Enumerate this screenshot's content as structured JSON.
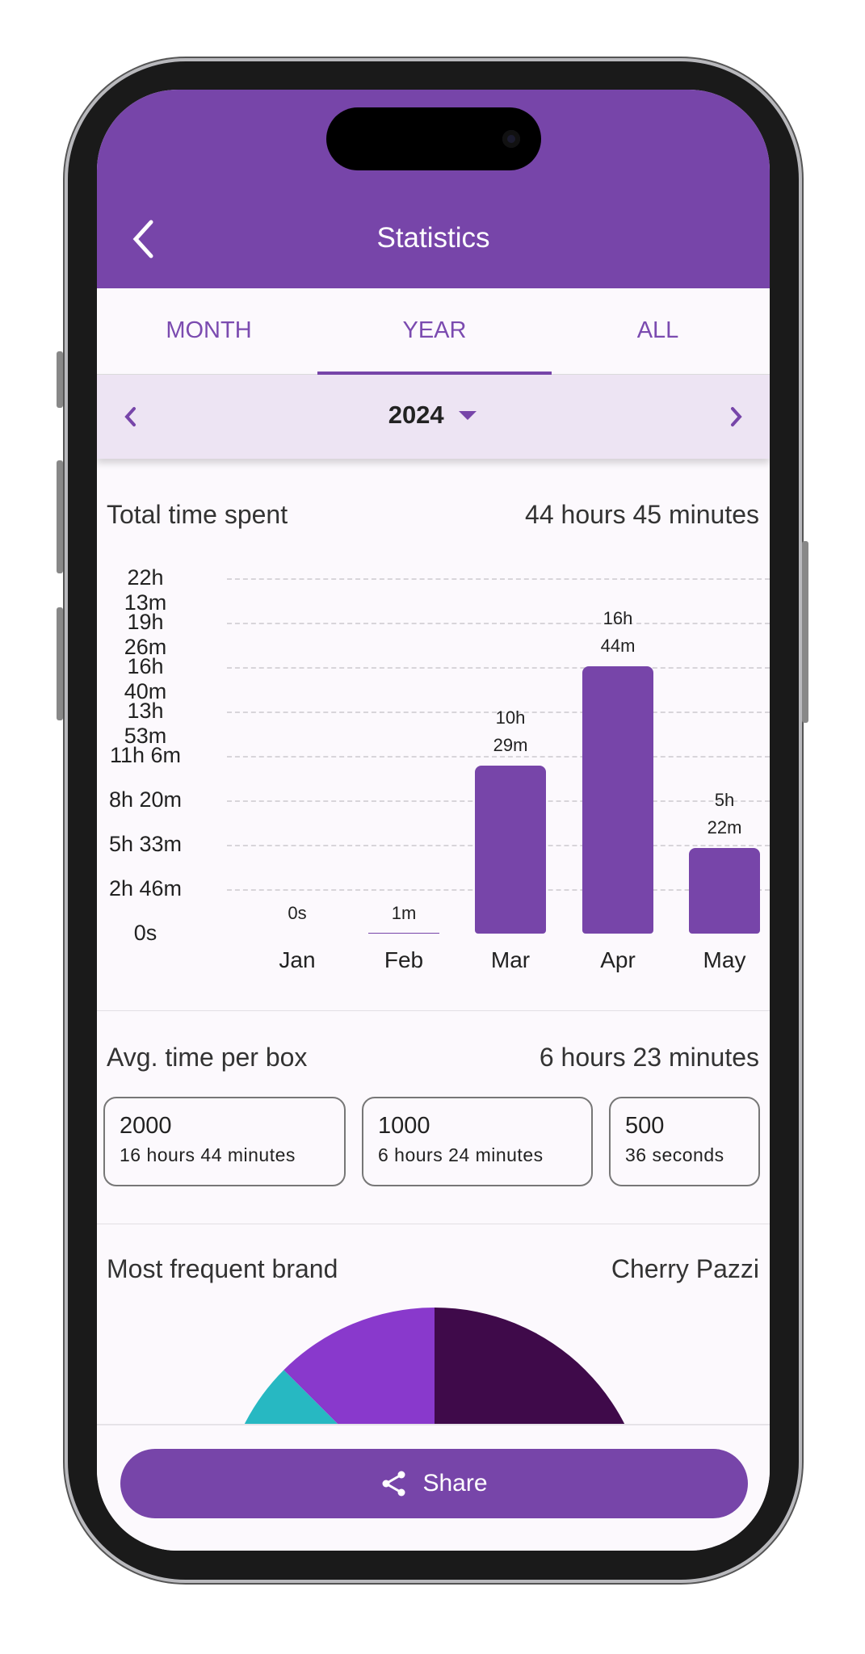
{
  "header": {
    "title": "Statistics",
    "back_icon": "chevron-left-icon"
  },
  "tabs": [
    {
      "label": "MONTH",
      "active": false
    },
    {
      "label": "YEAR",
      "active": true
    },
    {
      "label": "ALL",
      "active": false
    }
  ],
  "period": {
    "value": "2024",
    "prev_icon": "chevron-left-icon",
    "next_icon": "chevron-right-icon",
    "dropdown_icon": "caret-down-icon"
  },
  "total": {
    "label": "Total time spent",
    "value": "44 hours 45 minutes"
  },
  "avg": {
    "label": "Avg. time per box",
    "value": "6 hours 23 minutes",
    "boxes": [
      {
        "count": "2000",
        "time": "16 hours 44 minutes"
      },
      {
        "count": "1000",
        "time": "6 hours 24 minutes"
      },
      {
        "count": "500",
        "time": "36 seconds"
      }
    ]
  },
  "brand": {
    "label": "Most frequent brand",
    "value": "Cherry Pazzi"
  },
  "share": {
    "label": "Share",
    "icon": "share-icon"
  },
  "colors": {
    "accent": "#7745a9",
    "pie": [
      "#3f0a4a",
      "#8939cc",
      "#27b8c2"
    ]
  },
  "chart_data": [
    {
      "type": "bar",
      "unit": "minutes",
      "ylim": [
        0,
        1333
      ],
      "yticks": [
        "0s",
        "2h 46m",
        "5h 33m",
        "8h 20m",
        "11h 6m",
        "13h 53m",
        "16h 40m",
        "19h 26m",
        "22h 13m"
      ],
      "categories": [
        "Jan",
        "Feb",
        "Mar",
        "Apr",
        "May"
      ],
      "values": [
        0,
        1,
        629,
        1004,
        322
      ],
      "value_labels": [
        [
          "0s"
        ],
        [
          "1m"
        ],
        [
          "10h",
          "29m"
        ],
        [
          "16h",
          "44m"
        ],
        [
          "5h",
          "22m"
        ]
      ],
      "grid": true
    },
    {
      "type": "pie",
      "partially_visible": true,
      "slices": [
        {
          "color": "#3f0a4a",
          "start_deg": 0,
          "end_deg": 180
        },
        {
          "color": "#8939cc",
          "start_deg": -45,
          "end_deg": 0
        },
        {
          "color": "#27b8c2",
          "start_deg": -80,
          "end_deg": -45
        }
      ]
    }
  ]
}
